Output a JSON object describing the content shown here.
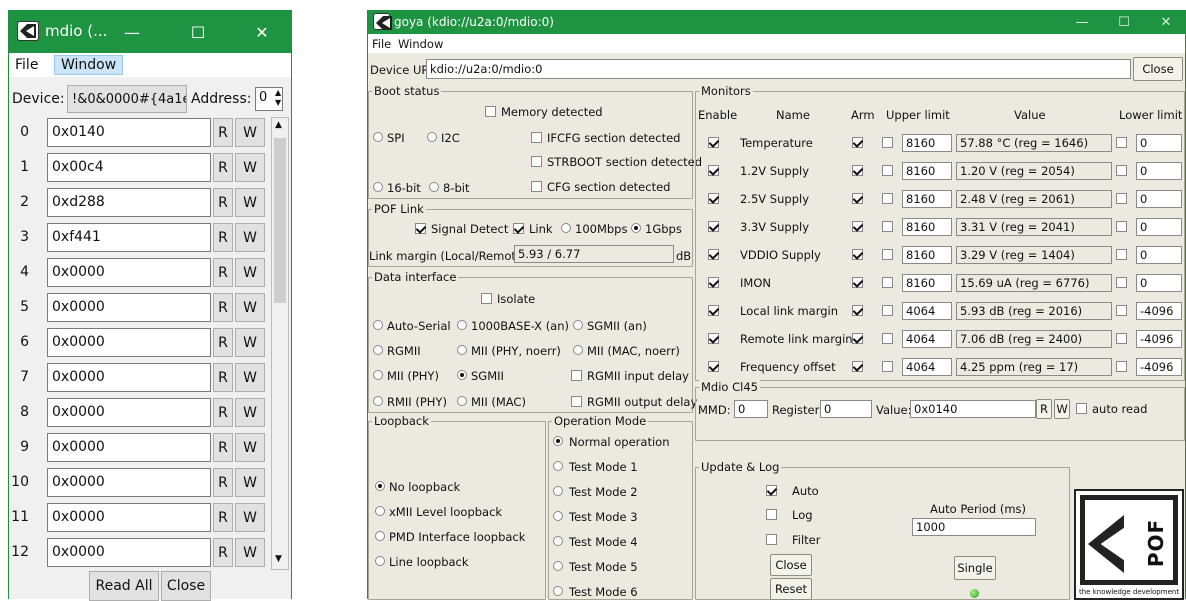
{
  "win1": {
    "title": "mdio (...",
    "menu": [
      "File",
      "Window"
    ],
    "device_label": "Device:",
    "device_value": "!&0&0000#{4a1e",
    "address_label": "Address:",
    "address_value": "0",
    "rows": [
      {
        "idx": "0",
        "val": "0x0140"
      },
      {
        "idx": "1",
        "val": "0x00c4"
      },
      {
        "idx": "2",
        "val": "0xd288"
      },
      {
        "idx": "3",
        "val": "0xf441"
      },
      {
        "idx": "4",
        "val": "0x0000"
      },
      {
        "idx": "5",
        "val": "0x0000"
      },
      {
        "idx": "6",
        "val": "0x0000"
      },
      {
        "idx": "7",
        "val": "0x0000"
      },
      {
        "idx": "8",
        "val": "0x0000"
      },
      {
        "idx": "9",
        "val": "0x0000"
      },
      {
        "idx": "10",
        "val": "0x0000"
      },
      {
        "idx": "11",
        "val": "0x0000"
      },
      {
        "idx": "12",
        "val": "0x0000"
      }
    ],
    "r": "R",
    "w": "W",
    "read_all": "Read All",
    "close": "Close"
  },
  "win2": {
    "title": "goya (kdio://u2a:0/mdio:0)",
    "menu": [
      "File",
      "Window"
    ],
    "url_label": "Device URL:",
    "url_value": "kdio://u2a:0/mdio:0",
    "close": "Close",
    "boot": {
      "title": "Boot status",
      "memory": "Memory detected",
      "spi": "SPI",
      "i2c": "I2C",
      "ifcfg": "IFCFG section detected",
      "strboot": "STRBOOT section detected",
      "bit16": "16-bit",
      "bit8": "8-bit",
      "cfg": "CFG section detected"
    },
    "pof": {
      "title": "POF Link",
      "signal": "Signal Detect",
      "link": "Link",
      "m100": "100Mbps",
      "g1": "1Gbps",
      "margin_label": "Link margin (Local/Remote)",
      "margin_value": "5.93 / 6.77",
      "db": "dB"
    },
    "data": {
      "title": "Data interface",
      "isolate": "Isolate",
      "auto_serial": "Auto-Serial",
      "base1000": "1000BASE-X (an)",
      "sgmii_an": "SGMII (an)",
      "rgmii": "RGMII",
      "mii_phy_noerr": "MII (PHY, noerr)",
      "mii_mac_noerr": "MII (MAC, noerr)",
      "mii_phy": "MII (PHY)",
      "sgmii": "SGMII",
      "rgmii_in": "RGMII input delay",
      "rmii_phy": "RMII (PHY)",
      "mii_mac": "MII (MAC)",
      "rgmii_out": "RGMII output delay"
    },
    "loop": {
      "title": "Loopback",
      "items": [
        "No loopback",
        "xMII Level loopback",
        "PMD Interface loopback",
        "Line loopback"
      ]
    },
    "opmode": {
      "title": "Operation Mode",
      "items": [
        "Normal operation",
        "Test Mode 1",
        "Test Mode 2",
        "Test Mode 3",
        "Test Mode 4",
        "Test Mode 5",
        "Test Mode 6"
      ]
    },
    "monitors": {
      "title": "Monitors",
      "h_enable": "Enable",
      "h_name": "Name",
      "h_arm": "Arm",
      "h_upper": "Upper limit",
      "h_value": "Value",
      "h_lower": "Lower limit",
      "rows": [
        {
          "name": "Temperature",
          "upper": "8160",
          "value": "57.88 °C (reg = 1646)",
          "lower": "0"
        },
        {
          "name": "1.2V Supply",
          "upper": "8160",
          "value": "1.20 V (reg = 2054)",
          "lower": "0"
        },
        {
          "name": "2.5V Supply",
          "upper": "8160",
          "value": "2.48 V (reg = 2061)",
          "lower": "0"
        },
        {
          "name": "3.3V Supply",
          "upper": "8160",
          "value": "3.31 V (reg = 2041)",
          "lower": "0"
        },
        {
          "name": "VDDIO Supply",
          "upper": "8160",
          "value": "3.29 V (reg = 1404)",
          "lower": "0"
        },
        {
          "name": "IMON",
          "upper": "8160",
          "value": "15.69 uA (reg = 6776)",
          "lower": "0"
        },
        {
          "name": "Local link margin",
          "upper": "4064",
          "value": "5.93 dB (reg = 2016)",
          "lower": "-4096"
        },
        {
          "name": "Remote link margin",
          "upper": "4064",
          "value": "7.06 dB (reg = 2400)",
          "lower": "-4096"
        },
        {
          "name": "Frequency offset",
          "upper": "4064",
          "value": "4.25 ppm (reg = 17)",
          "lower": "-4096"
        }
      ]
    },
    "mdio": {
      "title": "Mdio Cl45",
      "mmd_label": "MMD:",
      "mmd_value": "0",
      "reg_label": "Register:",
      "reg_value": "0",
      "val_label": "Value:",
      "val_value": "0x0140",
      "r": "R",
      "w": "W",
      "auto_read": "auto read"
    },
    "update": {
      "title": "Update & Log",
      "auto": "Auto",
      "log": "Log",
      "filter": "Filter",
      "close": "Close",
      "reset": "Reset",
      "period_label": "Auto Period (ms)",
      "period_value": "1000",
      "single": "Single"
    },
    "logo": {
      "text": "POF",
      "tagline": "the knowledge development"
    }
  }
}
